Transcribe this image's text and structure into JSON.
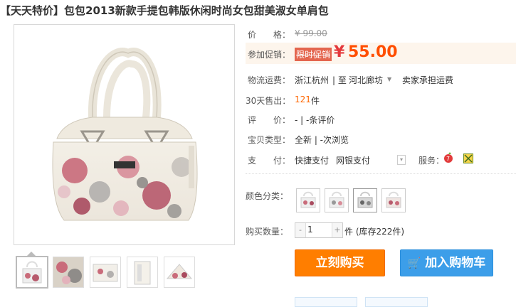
{
  "title": {
    "tag": "【天天特价】",
    "text": "包包2013新款手提包韩版休闲时尚女包甜美淑女单肩包"
  },
  "price": {
    "label": "价　　格：",
    "original": "¥ 99.00",
    "promo_label": "参加促销：",
    "promo_tag": "限时促销",
    "yen": "¥",
    "value": "55.00"
  },
  "shipping": {
    "label": "物流运费：",
    "from": "浙江杭州",
    "sep": "| 至",
    "to": "河北廊坊",
    "note": "卖家承担运费"
  },
  "sales": {
    "label": "30天售出：",
    "count": "121",
    "unit": "件"
  },
  "reviews": {
    "label": "评　　价：",
    "value": "-  |  -条评价"
  },
  "item_type": {
    "label": "宝贝类型：",
    "value": "全新  |  -次浏览"
  },
  "payment": {
    "label": "支　　付：",
    "methods": [
      "快捷支付",
      "网银支付"
    ],
    "service_label": "服务："
  },
  "color": {
    "label": "颜色分类："
  },
  "quantity": {
    "label": "购买数量：",
    "value": "1",
    "stock": "件 (库存222件)"
  },
  "buttons": {
    "buy": "立刻购买",
    "cart": "加入购物车"
  },
  "colors": {
    "price_red": "#ff4e00",
    "buy_orange": "#ff7e00",
    "cart_blue": "#3c9ee9"
  }
}
